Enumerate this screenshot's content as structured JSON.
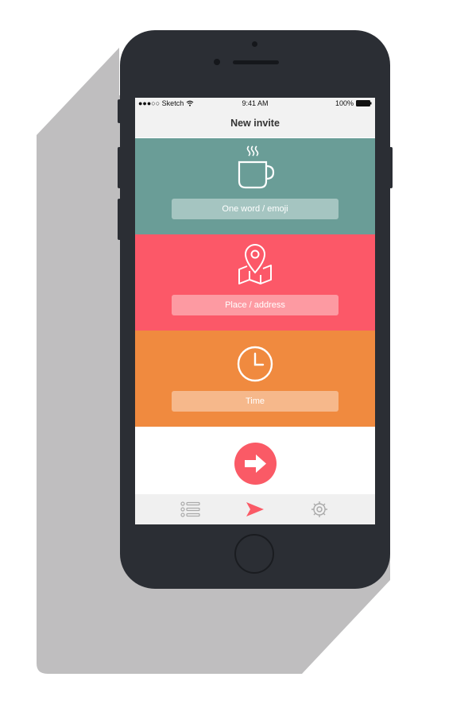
{
  "status_bar": {
    "carrier": "●●●○○ Sketch",
    "time": "9:41 AM",
    "battery": "100%"
  },
  "nav": {
    "title": "New invite"
  },
  "panels": [
    {
      "icon": "coffee-cup-icon",
      "placeholder": "One word / emoji",
      "color": "#6a9d97"
    },
    {
      "icon": "map-pin-icon",
      "placeholder": "Place / address",
      "color": "#fc5868"
    },
    {
      "icon": "clock-icon",
      "placeholder": "Time",
      "color": "#f08a3f"
    }
  ],
  "submit": {
    "icon": "arrow-right-icon",
    "color": "#fa5a66"
  },
  "tabs": [
    {
      "icon": "list-icon",
      "active": false
    },
    {
      "icon": "send-icon",
      "active": true
    },
    {
      "icon": "gear-icon",
      "active": false
    }
  ],
  "colors": {
    "phone_body": "#2b2e34",
    "shadow": "#bfbebf",
    "accent": "#fa5a66"
  }
}
